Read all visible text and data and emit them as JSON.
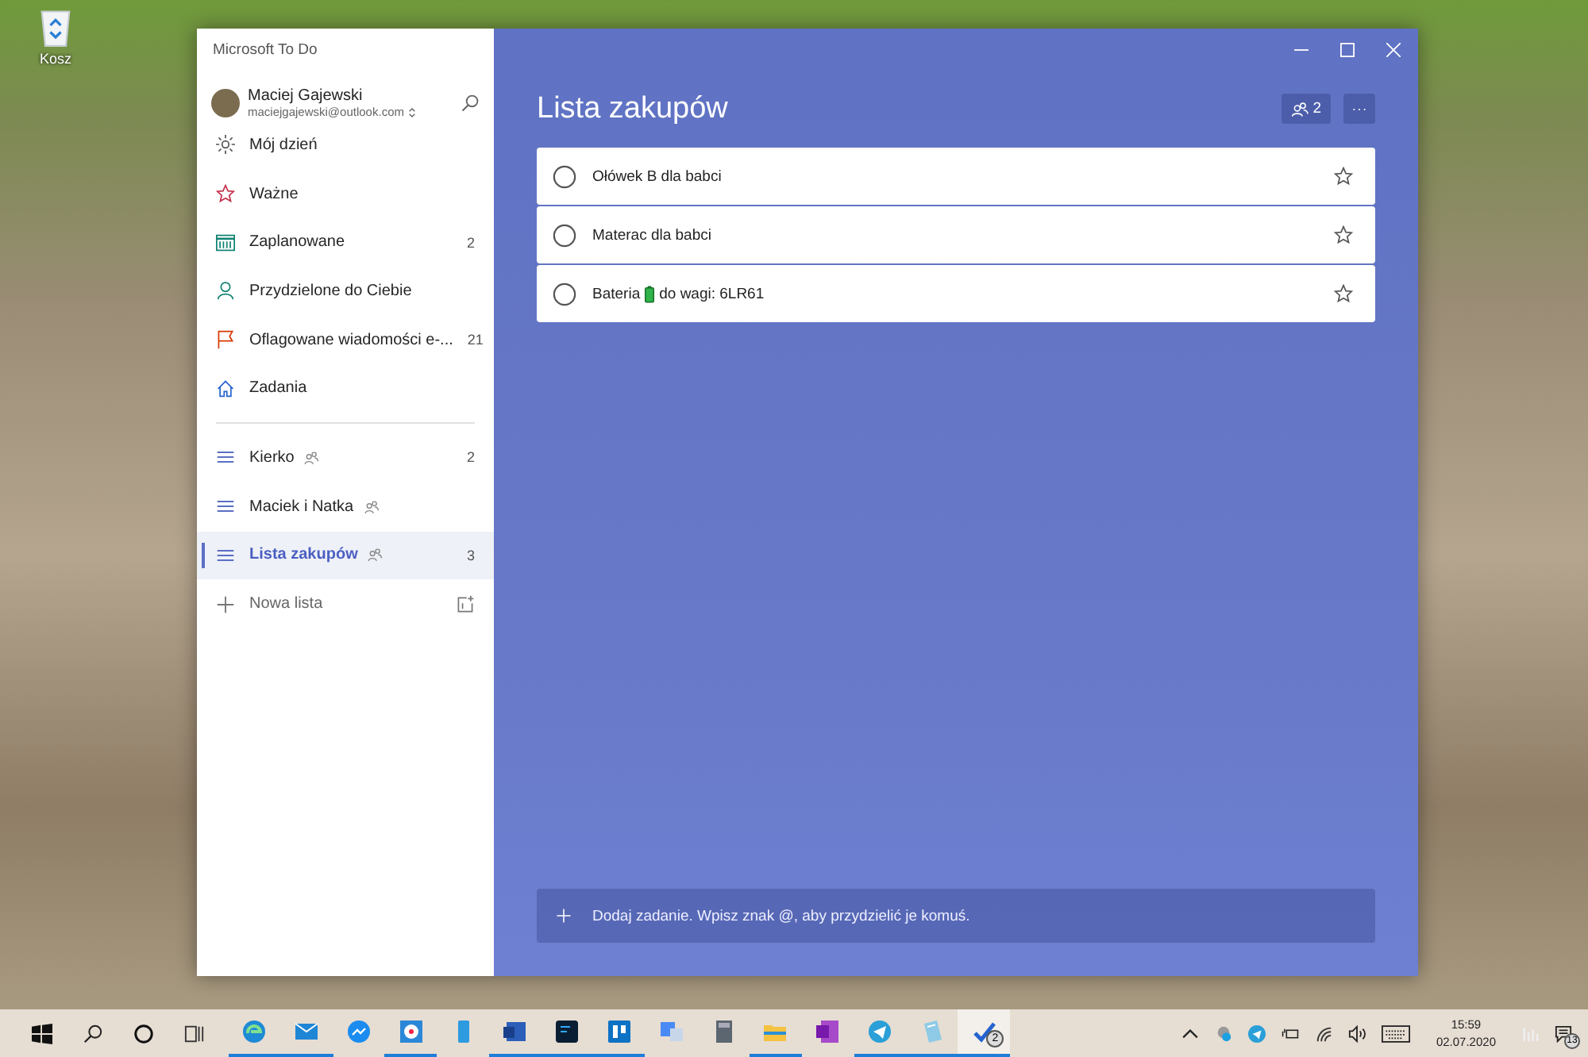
{
  "desktop": {
    "icons": [
      {
        "label": "Kosz"
      }
    ]
  },
  "window": {
    "title": "Microsoft To Do",
    "account": {
      "name": "Maciej Gajewski",
      "email": "maciejgajewski@outlook.com"
    },
    "smart_lists": [
      {
        "label": "Mój dzień",
        "selected": false
      },
      {
        "label": "Ważne",
        "selected": false
      },
      {
        "label": "Zaplanowane",
        "count": "2",
        "selected": false
      },
      {
        "label": "Przydzielone do Ciebie",
        "selected": false
      },
      {
        "label": "Oflagowane wiadomości e-...",
        "count": "21",
        "selected": false
      },
      {
        "label": "Zadania",
        "selected": false
      }
    ],
    "lists": [
      {
        "label": "Kierko",
        "shared": true,
        "count": "2",
        "selected": false
      },
      {
        "label": "Maciek i Natka",
        "shared": true,
        "selected": false
      },
      {
        "label": "Lista zakupów",
        "shared": true,
        "count": "3",
        "selected": true
      }
    ],
    "new_list": {
      "placeholder": "Nowa lista"
    },
    "header": {
      "title": "Lista zakupów",
      "members_count": "2"
    },
    "tasks": [
      {
        "text_parts": [
          "Ołówek B dla babci"
        ],
        "completed": false,
        "important": false
      },
      {
        "text_parts": [
          "Materac dla babci"
        ],
        "completed": false,
        "important": false
      },
      {
        "text_parts": [
          "Bateria",
          "do wagi: 6LR61"
        ],
        "completed": false,
        "important": false
      }
    ],
    "add_task": {
      "placeholder": "Dodaj zadanie. Wpisz znak @, aby przydzielić je komuś."
    }
  },
  "taskbar": {
    "apps": [
      {
        "running": true,
        "active": false
      },
      {
        "running": true,
        "active": false
      },
      {
        "running": false,
        "active": false
      },
      {
        "running": true,
        "active": false
      },
      {
        "running": false,
        "active": false
      },
      {
        "running": true,
        "active": false
      },
      {
        "running": true,
        "active": false
      },
      {
        "running": true,
        "active": false
      },
      {
        "running": false,
        "active": false
      },
      {
        "running": false,
        "active": false
      },
      {
        "running": true,
        "active": false
      },
      {
        "running": false,
        "active": false
      },
      {
        "running": true,
        "active": false
      },
      {
        "running": true,
        "active": false
      },
      {
        "running": true,
        "active": true,
        "badge": "2"
      }
    ],
    "time": "15:59",
    "date": "02.07.2020",
    "notifications": "13"
  }
}
